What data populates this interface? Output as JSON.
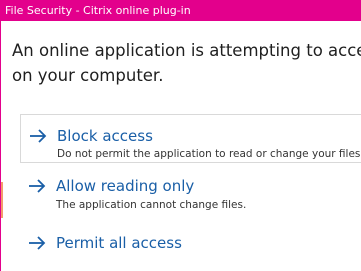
{
  "window": {
    "title": "File Security - Citrix online plug-in"
  },
  "prompt": {
    "line1": "An online application is attempting to access files",
    "line2": "on your computer."
  },
  "options": [
    {
      "id": "block",
      "title": "Block access",
      "description": "Do not permit the application to read or change your files.",
      "icon": "arrow-right-icon",
      "selected": true
    },
    {
      "id": "read",
      "title": "Allow reading only",
      "description": "The application cannot change files.",
      "icon": "arrow-right-icon",
      "selected": false
    },
    {
      "id": "permit",
      "title": "Permit all access",
      "description": "",
      "icon": "arrow-right-icon",
      "selected": false
    }
  ],
  "colors": {
    "titlebar": "#e3008c",
    "link": "#1a5fa7",
    "accent_edge": "#f39c6b"
  }
}
